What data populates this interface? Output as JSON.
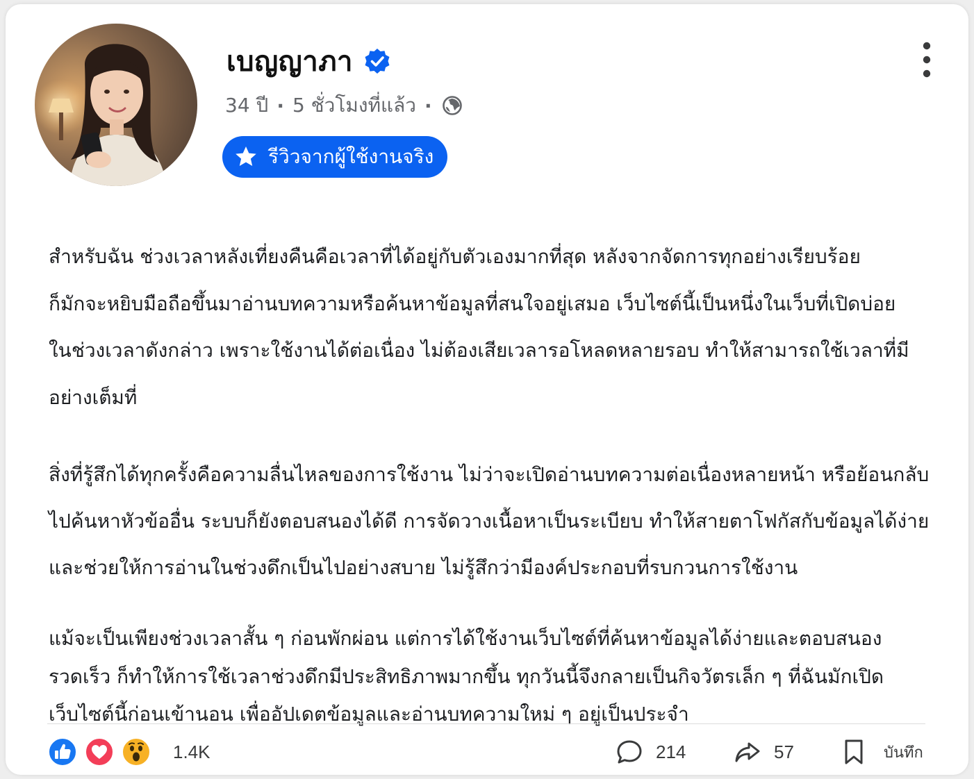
{
  "post": {
    "author": {
      "name": "เบญญาภา",
      "verified": true,
      "age": "34 ปี",
      "time": "5 ชั่วโมงที่แล้ว",
      "visibility_icon": "globe-icon"
    },
    "badge": {
      "icon": "star-icon",
      "label": "รีวิวจากผู้ใช้งานจริง"
    },
    "menu_icon": "more-vertical-icon",
    "paragraphs": [
      "สำหรับฉัน ช่วงเวลาหลังเที่ยงคืนคือเวลาที่ได้อยู่กับตัวเองมากที่สุด หลังจากจัดการทุกอย่างเรียบร้อย\nก็มักจะหยิบมือถือขึ้นมาอ่านบทความหรือค้นหาข้อมูลที่สนใจอยู่เสมอ เว็บไซต์นี้เป็นหนึ่งในเว็บที่เปิดบ่อย\nในช่วงเวลาดังกล่าว เพราะใช้งานได้ต่อเนื่อง ไม่ต้องเสียเวลารอโหลดหลายรอบ ทำให้สามารถใช้เวลาที่มี\nอย่างเต็มที่",
      "สิ่งที่รู้สึกได้ทุกครั้งคือความลื่นไหลของการใช้งาน ไม่ว่าจะเปิดอ่านบทความต่อเนื่องหลายหน้า หรือย้อนกลับ\nไปค้นหาหัวข้ออื่น ระบบก็ยังตอบสนองได้ดี การจัดวางเนื้อหาเป็นระเบียบ ทำให้สายตาโฟกัสกับข้อมูลได้ง่าย\nและช่วยให้การอ่านในช่วงดึกเป็นไปอย่างสบาย ไม่รู้สึกว่ามีองค์ประกอบที่รบกวนการใช้งาน",
      "แม้จะเป็นเพียงช่วงเวลาสั้น ๆ ก่อนพักผ่อน แต่การได้ใช้งานเว็บไซต์ที่ค้นหาข้อมูลได้ง่ายและตอบสนอง\nรวดเร็ว ก็ทำให้การใช้เวลาช่วงดึกมีประสิทธิภาพมากขึ้น ทุกวันนี้จึงกลายเป็นกิจวัตรเล็ก ๆ ที่ฉันมักเปิด\nเว็บไซต์นี้ก่อนเข้านอน เพื่ออัปเดตข้อมูลและอ่านบทความใหม่ ๆ อยู่เป็นประจำ"
    ],
    "footer": {
      "reactions": [
        "like-icon",
        "love-icon",
        "wow-icon"
      ],
      "reaction_count": "1.4K",
      "comments": "214",
      "shares": "57",
      "save_label": "บันทึก"
    }
  },
  "colors": {
    "accent": "#0b62f1",
    "like": "#1877f2",
    "love": "#f33e58",
    "wow": "#f7b125",
    "secondary_text": "#65676b"
  }
}
